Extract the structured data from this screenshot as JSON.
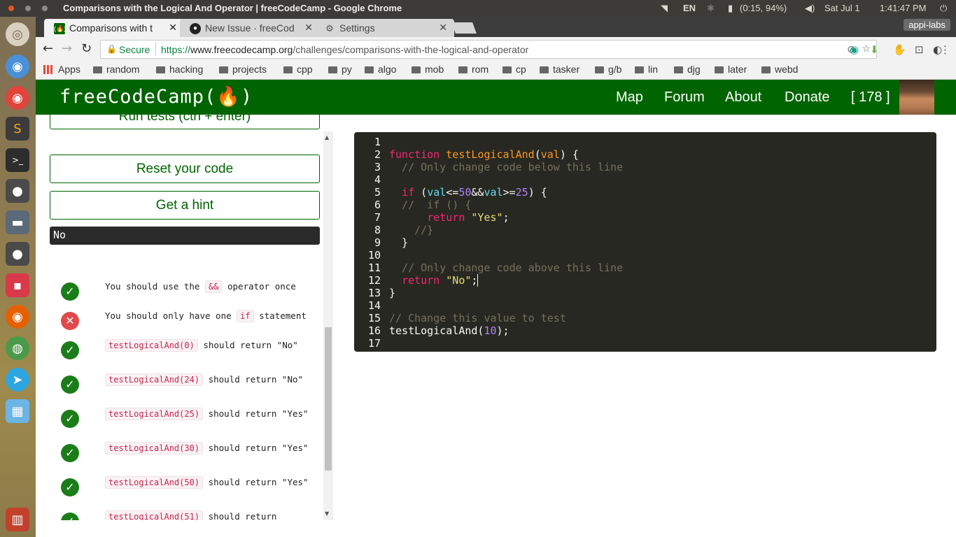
{
  "system": {
    "window_title": "Comparisons with the Logical And Operator | freeCodeCamp - Google Chrome",
    "keyboard": "EN",
    "battery": "(0:15, 94%)",
    "date": "Sat Jul 1",
    "time": "1:41:47 PM"
  },
  "browser": {
    "tabs": [
      {
        "label": "Comparisons with t",
        "icon": "fcc-icon"
      },
      {
        "label": "New Issue · freeCod",
        "icon": "github-icon"
      },
      {
        "label": "Settings",
        "icon": "gear-icon"
      }
    ],
    "profile": "appi-labs",
    "secure_label": "Secure",
    "url_scheme": "https://",
    "url_host": "www.freecodecamp.org",
    "url_path": "/challenges/comparisons-with-the-logical-and-operator",
    "bookmarks": [
      "Apps",
      "random",
      "hacking",
      "projects",
      "cpp",
      "py",
      "algo",
      "mob",
      "rom",
      "cp",
      "tasker",
      "g/b",
      "lin",
      "djg",
      "later",
      "webd"
    ]
  },
  "fcc": {
    "logo": "freeCodeCamp(🔥)",
    "nav": [
      "Map",
      "Forum",
      "About",
      "Donate",
      "[ 178 ]"
    ]
  },
  "challenge": {
    "run_tests": "Run tests (ctrl + enter)",
    "reset": "Reset your code",
    "hint": "Get a hint",
    "output": "No",
    "tests": [
      {
        "status": "pass",
        "pre": "You should use the ",
        "code": "&&",
        "post": " operator once"
      },
      {
        "status": "fail",
        "pre": "You should only have one ",
        "code": "if",
        "post": " statement"
      },
      {
        "status": "pass",
        "pre": "",
        "code": "testLogicalAnd(0)",
        "post": " should return \"No\""
      },
      {
        "status": "pass",
        "pre": "",
        "code": "testLogicalAnd(24)",
        "post": " should return \"No\""
      },
      {
        "status": "pass",
        "pre": "",
        "code": "testLogicalAnd(25)",
        "post": " should return \"Yes\""
      },
      {
        "status": "pass",
        "pre": "",
        "code": "testLogicalAnd(30)",
        "post": " should return \"Yes\""
      },
      {
        "status": "pass",
        "pre": "",
        "code": "testLogicalAnd(50)",
        "post": " should return \"Yes\""
      },
      {
        "status": "pass",
        "pre": "",
        "code": "testLogicalAnd(51)",
        "post": " should return"
      }
    ]
  },
  "editor": {
    "lines": [
      "",
      "function testLogicalAnd(val) {",
      "  // Only change code below this line",
      "",
      "  if (val<=50&&val>=25) {",
      "  //  if () {",
      "      return \"Yes\";",
      "    //}",
      "  }",
      "",
      "  // Only change code above this line",
      "  return \"No\";",
      "}",
      "",
      "// Change this value to test",
      "testLogicalAnd(10);",
      ""
    ]
  }
}
